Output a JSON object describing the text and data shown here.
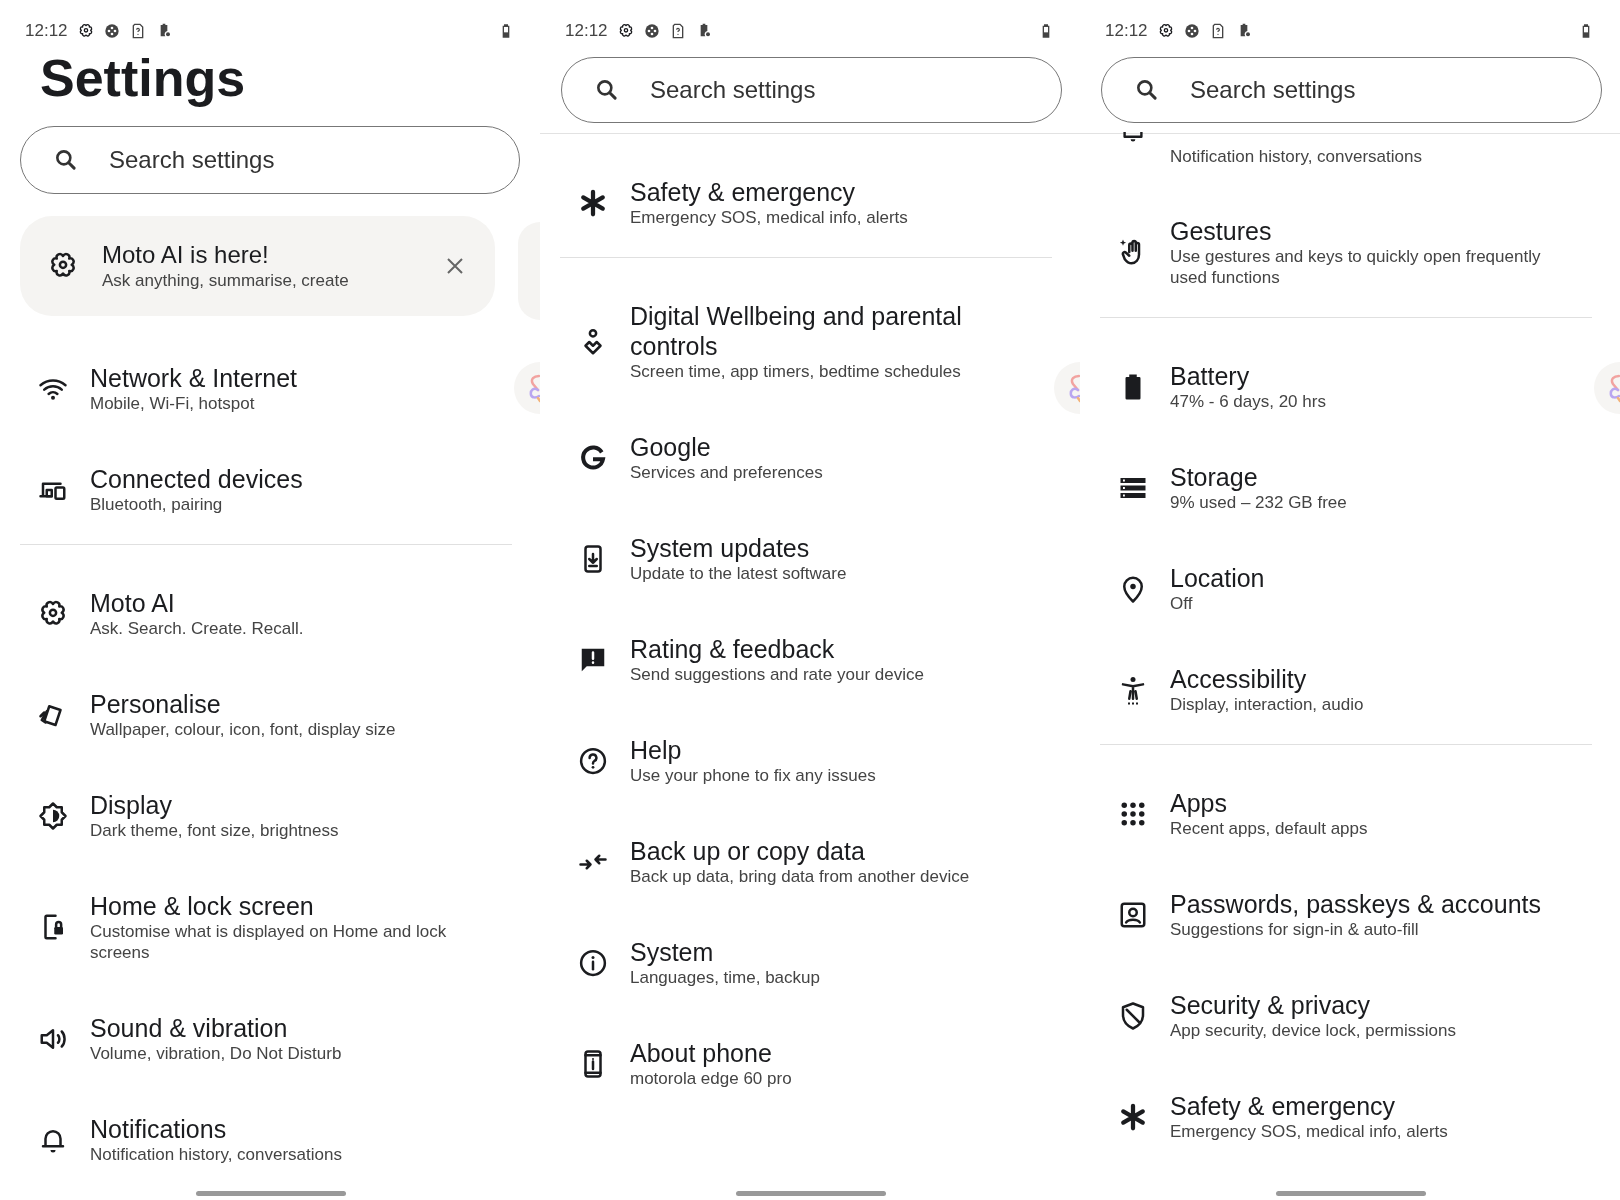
{
  "panels": [
    {
      "status_bar": {
        "time": "12:12"
      },
      "title": "Settings",
      "search": {
        "placeholder": "Search settings"
      },
      "promo": {
        "title": "Moto AI is here!",
        "subtitle": "Ask anything, summarise, create"
      },
      "groups": [
        [
          {
            "title": "Network & Internet",
            "subtitle": "Mobile, Wi-Fi, hotspot"
          },
          {
            "title": "Connected devices",
            "subtitle": "Bluetooth, pairing"
          }
        ],
        [
          {
            "title": "Moto AI",
            "subtitle": "Ask. Search. Create. Recall."
          },
          {
            "title": "Personalise",
            "subtitle": "Wallpaper, colour, icon, font, display size"
          },
          {
            "title": "Display",
            "subtitle": "Dark theme, font size, brightness"
          },
          {
            "title": "Home & lock screen",
            "subtitle": "Customise what is displayed on Home and lock screens"
          },
          {
            "title": "Sound & vibration",
            "subtitle": "Volume, vibration, Do Not Disturb"
          },
          {
            "title": "Notifications",
            "subtitle": "Notification history, conversations"
          }
        ]
      ]
    },
    {
      "status_bar": {
        "time": "12:12"
      },
      "search": {
        "placeholder": "Search settings"
      },
      "groups": [
        [
          {
            "title": "Safety & emergency",
            "subtitle": "Emergency SOS, medical info, alerts"
          }
        ],
        [
          {
            "title": "Digital Wellbeing and parental controls",
            "subtitle": "Screen time, app timers, bedtime schedules"
          },
          {
            "title": "Google",
            "subtitle": "Services and preferences"
          },
          {
            "title": "System updates",
            "subtitle": "Update to the latest software"
          },
          {
            "title": "Rating & feedback",
            "subtitle": "Send suggestions and rate your device"
          },
          {
            "title": "Help",
            "subtitle": "Use your phone to fix any issues"
          },
          {
            "title": "Back up or copy data",
            "subtitle": "Back up data, bring data from another device"
          },
          {
            "title": "System",
            "subtitle": "Languages, time, backup"
          },
          {
            "title": "About phone",
            "subtitle": "motorola edge 60 pro"
          }
        ]
      ]
    },
    {
      "status_bar": {
        "time": "12:12"
      },
      "search": {
        "placeholder": "Search settings"
      },
      "groups": [
        [
          {
            "subtitle": "Notification history, conversations"
          },
          {
            "title": "Gestures",
            "subtitle": "Use gestures and keys to quickly open frequently used functions"
          }
        ],
        [
          {
            "title": "Battery",
            "subtitle": "47% - 6 days, 20 hrs"
          },
          {
            "title": "Storage",
            "subtitle": "9% used – 232 GB free"
          },
          {
            "title": "Location",
            "subtitle": "Off"
          },
          {
            "title": "Accessibility",
            "subtitle": "Display, interaction, audio"
          }
        ],
        [
          {
            "title": "Apps",
            "subtitle": "Recent apps, default apps"
          },
          {
            "title": "Passwords, passkeys & accounts",
            "subtitle": "Suggestions for sign-in & auto-fill"
          },
          {
            "title": "Security & privacy",
            "subtitle": "App security, device lock, permissions"
          },
          {
            "title": "Safety & emergency",
            "subtitle": "Emergency SOS, medical info, alerts"
          }
        ]
      ]
    }
  ]
}
